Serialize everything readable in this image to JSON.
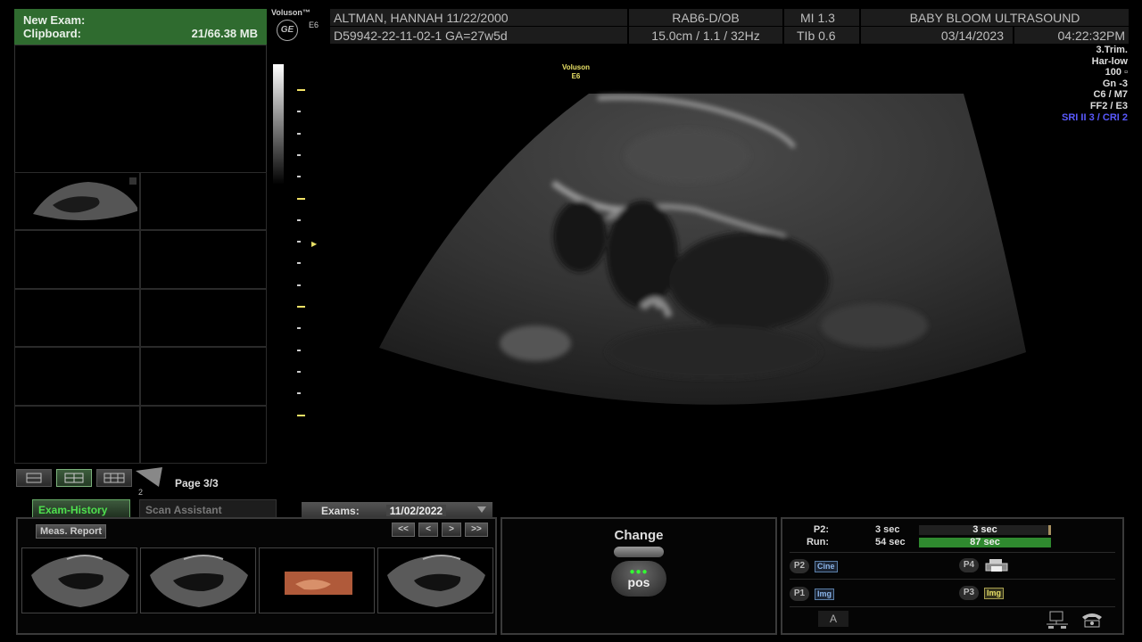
{
  "clipboard": {
    "title": "New Exam:",
    "label": "Clipboard:",
    "size": "21/66.38 MB"
  },
  "layout": {
    "page": "Page 3/3",
    "small_num": "2"
  },
  "tabs": {
    "exam_history": "Exam-History",
    "scan_assistant": "Scan Assistant",
    "exams_label": "Exams:",
    "exams_date": "11/02/2022"
  },
  "history": {
    "meas_report": "Meas. Report",
    "nav": [
      "<<",
      "<",
      ">",
      ">>"
    ]
  },
  "change": {
    "title": "Change",
    "knob_label": "pos",
    "knob_dots": "●●●"
  },
  "timers": {
    "p2_label": "P2:",
    "p2_val": "3 sec",
    "p2_bar": "3 sec",
    "p2_fill": 0.02,
    "run_label": "Run:",
    "run_val": "54 sec",
    "run_bar": "87 sec",
    "run_fill": 1.0
  },
  "pbuttons": {
    "p2": "P2",
    "p2_tag": "Cine",
    "p4": "P4",
    "p1": "P1",
    "p1_tag": "Img",
    "p3": "P3",
    "p3_tag": "Img",
    "a_key": "A"
  },
  "header": {
    "brand": "Voluson™",
    "model": "E6",
    "ge": "GE",
    "patient": "ALTMAN, HANNAH  11/22/2000",
    "probe": "RAB6-D/OB",
    "mi": "MI  1.3",
    "clinic": "BABY BLOOM ULTRASOUND",
    "exam_id": "D59942-22-11-02-1  GA=27w5d",
    "depth": "15.0cm / 1.1 / 32Hz",
    "tib": "TIb  0.6",
    "date": "03/14/2023",
    "time": "04:22:32PM"
  },
  "params": {
    "trim": "3.Trim.",
    "har": "Har-low",
    "power": "100",
    "gain": "Gn  -3",
    "c": "C6 / M7",
    "ff": "FF2 / E3",
    "sri": "SRI II 3 / CRI 2"
  },
  "image_label": {
    "brand": "Voluson",
    "model": "E6"
  },
  "colors": {
    "accent_green": "#2f6b2f",
    "tab_green": "#4fe04f",
    "focus_yellow": "#f2e266",
    "sri_blue": "#5a5aff"
  }
}
